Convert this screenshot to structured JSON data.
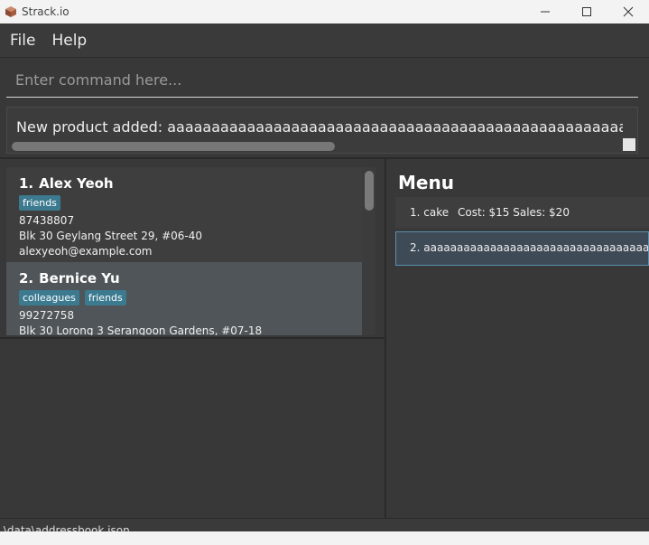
{
  "window": {
    "title": "Strack.io"
  },
  "menubar": {
    "items": [
      "File",
      "Help"
    ]
  },
  "command": {
    "placeholder": "Enter command here..."
  },
  "result": {
    "text": "New product added: aaaaaaaaaaaaaaaaaaaaaaaaaaaaaaaaaaaaaaaaaaaaaaaaaaaaaaaaaaaaaaaaaaaaaaaaaa"
  },
  "persons": [
    {
      "index": "1.",
      "name": "Alex Yeoh",
      "tags": [
        "friends"
      ],
      "phone": "87438807",
      "address": "Blk 30 Geylang Street 29, #06-40",
      "email": "alexyeoh@example.com"
    },
    {
      "index": "2.",
      "name": "Bernice Yu",
      "tags": [
        "colleagues",
        "friends"
      ],
      "phone": "99272758",
      "address": "Blk 30 Lorong 3 Serangoon Gardens, #07-18",
      "email": ""
    }
  ],
  "menu_panel": {
    "title": "Menu",
    "products": [
      {
        "index": "1.",
        "name": "cake",
        "cost": "Cost: $15",
        "sales": "Sales: $20"
      },
      {
        "index": "2.",
        "name": "aaaaaaaaaaaaaaaaaaaaaaaaaaaaaaaaaaaaaaaaaaaaaaaaaa",
        "cost": "",
        "sales": ""
      }
    ]
  },
  "statusbar": {
    "path": ".\\data\\addressbook.json"
  },
  "colors": {
    "tag_bg": "#3c7a90",
    "selected_border": "#5b8fae"
  }
}
